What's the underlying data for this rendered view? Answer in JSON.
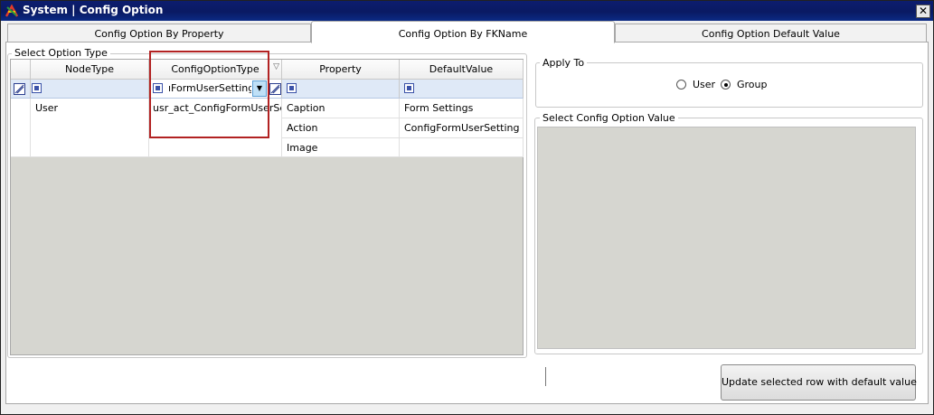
{
  "window": {
    "title": "System | Config Option",
    "close_glyph": "✕"
  },
  "tabs": [
    {
      "label": "Config Option By Property",
      "active": false
    },
    {
      "label": "Config Option By FKName",
      "active": true
    },
    {
      "label": "Config Option Default Value",
      "active": false
    }
  ],
  "option_type": {
    "legend": "Select Option Type",
    "columns": [
      "NodeType",
      "ConfigOptionType",
      "Property",
      "DefaultValue"
    ],
    "filter_value": "ıFormUserSetting",
    "rows": [
      {
        "node_type": "User",
        "config_option_type": "usr_act_ConfigFormUserSet",
        "property": "Caption",
        "default_value": "Form Settings"
      },
      {
        "node_type": "",
        "config_option_type": "",
        "property": "Action",
        "default_value": "ConfigFormUserSetting"
      },
      {
        "node_type": "",
        "config_option_type": "",
        "property": "Image",
        "default_value": ""
      }
    ]
  },
  "apply_to": {
    "legend": "Apply To",
    "options": [
      {
        "label": "User",
        "selected": false
      },
      {
        "label": "Group",
        "selected": true
      }
    ]
  },
  "config_value": {
    "legend": "Select Config Option Value"
  },
  "update_button": {
    "label": "Update selected row with default value"
  },
  "colors": {
    "title_bar": "#0b1d6c",
    "highlight_box": "#b22222",
    "grid_empty": "#d6d6d0",
    "filter_row": "#dfe9f7"
  }
}
